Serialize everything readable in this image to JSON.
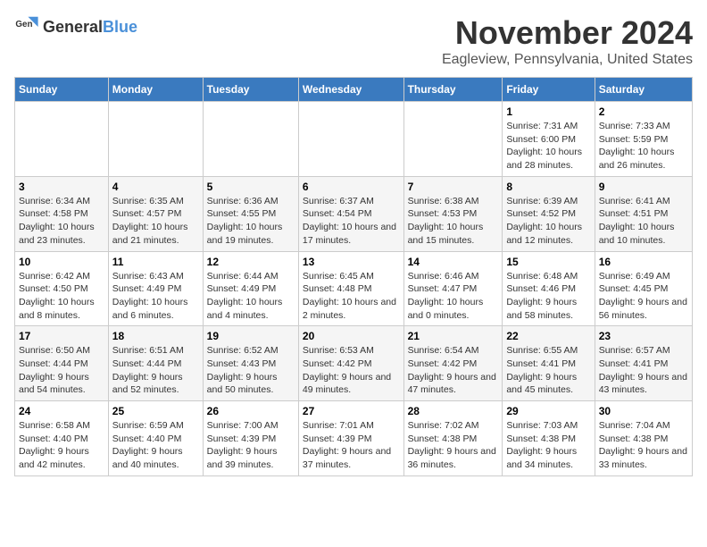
{
  "header": {
    "logo_general": "General",
    "logo_blue": "Blue",
    "month_title": "November 2024",
    "location": "Eagleview, Pennsylvania, United States"
  },
  "days_of_week": [
    "Sunday",
    "Monday",
    "Tuesday",
    "Wednesday",
    "Thursday",
    "Friday",
    "Saturday"
  ],
  "weeks": [
    {
      "days": [
        {
          "number": "",
          "info": ""
        },
        {
          "number": "",
          "info": ""
        },
        {
          "number": "",
          "info": ""
        },
        {
          "number": "",
          "info": ""
        },
        {
          "number": "",
          "info": ""
        },
        {
          "number": "1",
          "info": "Sunrise: 7:31 AM\nSunset: 6:00 PM\nDaylight: 10 hours and 28 minutes."
        },
        {
          "number": "2",
          "info": "Sunrise: 7:33 AM\nSunset: 5:59 PM\nDaylight: 10 hours and 26 minutes."
        }
      ]
    },
    {
      "days": [
        {
          "number": "3",
          "info": "Sunrise: 6:34 AM\nSunset: 4:58 PM\nDaylight: 10 hours and 23 minutes."
        },
        {
          "number": "4",
          "info": "Sunrise: 6:35 AM\nSunset: 4:57 PM\nDaylight: 10 hours and 21 minutes."
        },
        {
          "number": "5",
          "info": "Sunrise: 6:36 AM\nSunset: 4:55 PM\nDaylight: 10 hours and 19 minutes."
        },
        {
          "number": "6",
          "info": "Sunrise: 6:37 AM\nSunset: 4:54 PM\nDaylight: 10 hours and 17 minutes."
        },
        {
          "number": "7",
          "info": "Sunrise: 6:38 AM\nSunset: 4:53 PM\nDaylight: 10 hours and 15 minutes."
        },
        {
          "number": "8",
          "info": "Sunrise: 6:39 AM\nSunset: 4:52 PM\nDaylight: 10 hours and 12 minutes."
        },
        {
          "number": "9",
          "info": "Sunrise: 6:41 AM\nSunset: 4:51 PM\nDaylight: 10 hours and 10 minutes."
        }
      ]
    },
    {
      "days": [
        {
          "number": "10",
          "info": "Sunrise: 6:42 AM\nSunset: 4:50 PM\nDaylight: 10 hours and 8 minutes."
        },
        {
          "number": "11",
          "info": "Sunrise: 6:43 AM\nSunset: 4:49 PM\nDaylight: 10 hours and 6 minutes."
        },
        {
          "number": "12",
          "info": "Sunrise: 6:44 AM\nSunset: 4:49 PM\nDaylight: 10 hours and 4 minutes."
        },
        {
          "number": "13",
          "info": "Sunrise: 6:45 AM\nSunset: 4:48 PM\nDaylight: 10 hours and 2 minutes."
        },
        {
          "number": "14",
          "info": "Sunrise: 6:46 AM\nSunset: 4:47 PM\nDaylight: 10 hours and 0 minutes."
        },
        {
          "number": "15",
          "info": "Sunrise: 6:48 AM\nSunset: 4:46 PM\nDaylight: 9 hours and 58 minutes."
        },
        {
          "number": "16",
          "info": "Sunrise: 6:49 AM\nSunset: 4:45 PM\nDaylight: 9 hours and 56 minutes."
        }
      ]
    },
    {
      "days": [
        {
          "number": "17",
          "info": "Sunrise: 6:50 AM\nSunset: 4:44 PM\nDaylight: 9 hours and 54 minutes."
        },
        {
          "number": "18",
          "info": "Sunrise: 6:51 AM\nSunset: 4:44 PM\nDaylight: 9 hours and 52 minutes."
        },
        {
          "number": "19",
          "info": "Sunrise: 6:52 AM\nSunset: 4:43 PM\nDaylight: 9 hours and 50 minutes."
        },
        {
          "number": "20",
          "info": "Sunrise: 6:53 AM\nSunset: 4:42 PM\nDaylight: 9 hours and 49 minutes."
        },
        {
          "number": "21",
          "info": "Sunrise: 6:54 AM\nSunset: 4:42 PM\nDaylight: 9 hours and 47 minutes."
        },
        {
          "number": "22",
          "info": "Sunrise: 6:55 AM\nSunset: 4:41 PM\nDaylight: 9 hours and 45 minutes."
        },
        {
          "number": "23",
          "info": "Sunrise: 6:57 AM\nSunset: 4:41 PM\nDaylight: 9 hours and 43 minutes."
        }
      ]
    },
    {
      "days": [
        {
          "number": "24",
          "info": "Sunrise: 6:58 AM\nSunset: 4:40 PM\nDaylight: 9 hours and 42 minutes."
        },
        {
          "number": "25",
          "info": "Sunrise: 6:59 AM\nSunset: 4:40 PM\nDaylight: 9 hours and 40 minutes."
        },
        {
          "number": "26",
          "info": "Sunrise: 7:00 AM\nSunset: 4:39 PM\nDaylight: 9 hours and 39 minutes."
        },
        {
          "number": "27",
          "info": "Sunrise: 7:01 AM\nSunset: 4:39 PM\nDaylight: 9 hours and 37 minutes."
        },
        {
          "number": "28",
          "info": "Sunrise: 7:02 AM\nSunset: 4:38 PM\nDaylight: 9 hours and 36 minutes."
        },
        {
          "number": "29",
          "info": "Sunrise: 7:03 AM\nSunset: 4:38 PM\nDaylight: 9 hours and 34 minutes."
        },
        {
          "number": "30",
          "info": "Sunrise: 7:04 AM\nSunset: 4:38 PM\nDaylight: 9 hours and 33 minutes."
        }
      ]
    }
  ]
}
